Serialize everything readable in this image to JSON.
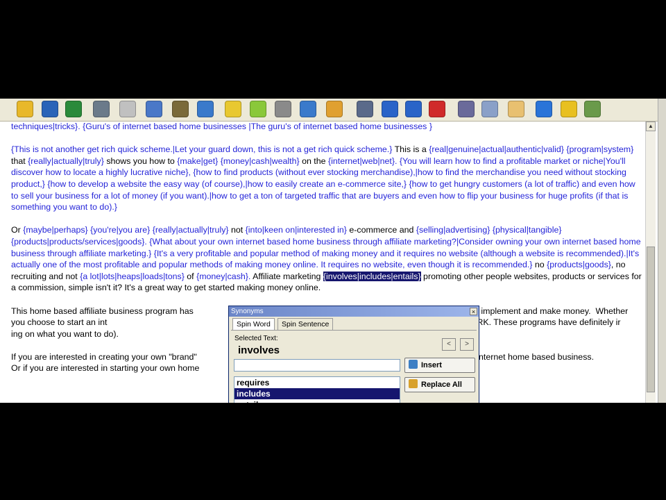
{
  "toolbar": {
    "icons": [
      "open-folder-icon",
      "save-icon",
      "save-as-icon",
      "print-icon",
      "notepad-icon",
      "pencil-icon",
      "magic-wand-icon",
      "spell-check-icon",
      "star-icon",
      "highlighter-icon",
      "link-icon",
      "book-icon",
      "image-icon",
      "document-check-icon",
      "undo-icon",
      "redo-icon",
      "delete-icon",
      "cut-icon",
      "copy-icon",
      "paste-icon",
      "help-icon",
      "key-icon",
      "exit-icon"
    ]
  },
  "editor": {
    "line0": "techniques|tricks}. {Guru's of internet based home businesses |The guru's of internet based home businesses }",
    "p1": [
      {
        "t": "{This is not another get rich quick scheme.|Let your guard down, this is not a get rich quick scheme.}",
        "s": 1
      },
      {
        "t": " This is a ",
        "s": 0
      },
      {
        "t": "{real|genuine|actual|authentic|valid}",
        "s": 1
      },
      {
        "t": " ",
        "s": 0
      },
      {
        "t": "{program|system}",
        "s": 1
      },
      {
        "t": " that ",
        "s": 0
      },
      {
        "t": "{really|actually|truly}",
        "s": 1
      },
      {
        "t": " shows you how to ",
        "s": 0
      },
      {
        "t": "{make|get}",
        "s": 1
      },
      {
        "t": " ",
        "s": 0
      },
      {
        "t": "{money|cash|wealth}",
        "s": 1
      },
      {
        "t": " on the ",
        "s": 0
      },
      {
        "t": "{internet|web|net}. {You will learn how to find a profitable market or niche|You'll discover how to locate a highly lucrative niche}, {how to find products (without ever stocking merchandise),|how to find the merchandise you need without stocking product,} {how to develop a website the easy way (of course),|how to easily create an e-commerce site,} {how to get hungry customers (a lot of traffic) and even how to sell your business for a lot of money (if you want).|how to get a ton of targeted traffic that are buyers and even how to flip your business for huge profits (if that is something you want to do).}",
        "s": 1
      }
    ],
    "p2": [
      {
        "t": "Or ",
        "s": 0
      },
      {
        "t": "{maybe|perhaps}",
        "s": 1
      },
      {
        "t": " ",
        "s": 0
      },
      {
        "t": "{you're|you are}",
        "s": 1
      },
      {
        "t": " ",
        "s": 0
      },
      {
        "t": "{really|actually|truly}",
        "s": 1
      },
      {
        "t": " not ",
        "s": 0
      },
      {
        "t": "{into|keen on|interested in}",
        "s": 1
      },
      {
        "t": " e-commerce and ",
        "s": 0
      },
      {
        "t": "{selling|advertising}",
        "s": 1
      },
      {
        "t": " ",
        "s": 0
      },
      {
        "t": "{physical|tangible}",
        "s": 1
      },
      {
        "t": " ",
        "s": 0
      },
      {
        "t": "{products|products/services|goods}. {What about your own internet based home business through affiliate marketing?|Consider owning your own internet based home business through affiliate marketing.} {It's a very profitable and popular method of making money and it requires no website (although a website is recommended).|It's actually one of the most profitable and popular methods of making money online. It requires no website, even though it is recommended.}",
        "s": 1
      },
      {
        "t": " no ",
        "s": 0
      },
      {
        "t": "{products|goods}",
        "s": 1
      },
      {
        "t": ", no recruiting and not ",
        "s": 0
      },
      {
        "t": "{a lot|lots|heaps|loads|tons}",
        "s": 1
      },
      {
        "t": " of ",
        "s": 0
      },
      {
        "t": "{money|cash}.",
        "s": 1
      },
      {
        "t": " Affiliate marketing ",
        "s": 0
      },
      {
        "t": "{involves|includes|entails}",
        "s": 2
      },
      {
        "t": " promoting other people websites, products or services for a commission, simple isn't it? It's a great way to get started making money online.",
        "s": 0
      }
    ],
    "p3": [
      {
        "t": "This home based affiliate business program has",
        "s": 0
      },
      {
        "t": "                                                                                       y and even easier to implement and make money.  Whether you choose to start an int",
        "s": 0
      },
      {
        "t": "                                                                              products or affiliate marketing, THEY BOTH WORK. These programs have definitely ir",
        "s": 0
      },
      {
        "t": "                                                                              ing on what you want to do).",
        "s": 0
      }
    ],
    "p4": [
      {
        "t": "If you are interested in creating your own \"brand\"",
        "s": 0
      },
      {
        "t": "                                                                                     click here - the best internet home based business.",
        "s": 0
      }
    ],
    "p5": "Or if you are interested in starting your own home"
  },
  "dialog": {
    "title": "Synonyms",
    "close": "×",
    "tabs": [
      "Spin Word",
      "Spin Sentence"
    ],
    "selected_label": "Selected Text:",
    "selected_word": "involves",
    "prev": "<",
    "next": ">",
    "insert_label": "Insert",
    "replace_all_label": "Replace All",
    "synonyms": [
      "requires",
      "includes",
      "entails"
    ]
  }
}
